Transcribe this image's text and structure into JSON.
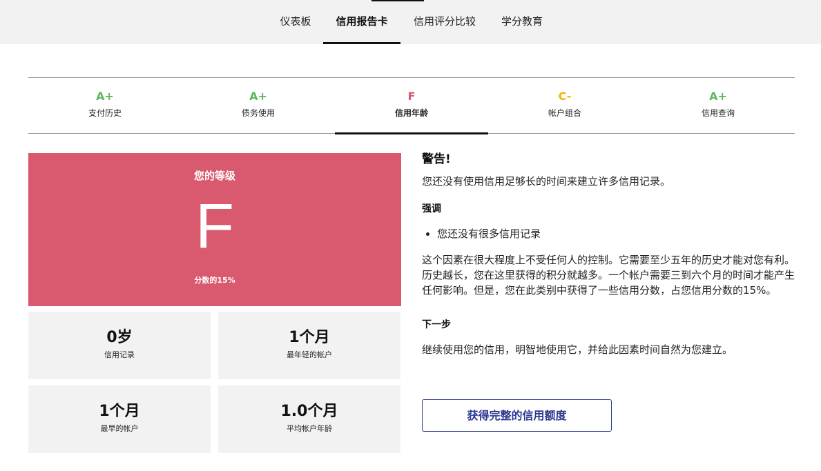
{
  "nav": {
    "tabs": [
      {
        "label": "仪表板"
      },
      {
        "label": "信用报告卡"
      },
      {
        "label": "信用评分比较"
      },
      {
        "label": "学分教育"
      }
    ],
    "active_index": 1
  },
  "grades": [
    {
      "grade": "A+",
      "name": "支付历史",
      "color": "#5cb85c"
    },
    {
      "grade": "A+",
      "name": "债务使用",
      "color": "#5cb85c"
    },
    {
      "grade": "F",
      "name": "信用年龄",
      "color": "#d9596e"
    },
    {
      "grade": "C-",
      "name": "帐户组合",
      "color": "#f0b400"
    },
    {
      "grade": "A+",
      "name": "信用查询",
      "color": "#5cb85c"
    }
  ],
  "active_grade_index": 2,
  "grade_card": {
    "title": "您的等级",
    "letter": "F",
    "score_text": "分数的15%",
    "color": "#d9596e"
  },
  "stats": [
    {
      "value": "0岁",
      "label": "信用记录"
    },
    {
      "value": "1个月",
      "label": "最年轻的帐户"
    },
    {
      "value": "1个月",
      "label": "最早的帐户"
    },
    {
      "value": "1.0个月",
      "label": "平均帐户年龄"
    }
  ],
  "detail": {
    "warning_title": "警告!",
    "warning_text": "您还没有使用信用足够长的时间来建立许多信用记录。",
    "emphasis_title": "强调",
    "bullets": [
      "您还没有很多信用记录"
    ],
    "paragraph": "这个因素在很大程度上不受任何人的控制。它需要至少五年的历史才能对您有利。历史越长，您在这里获得的积分就越多。一个帐户需要三到六个月的时间才能产生任何影响。但是，您在此类别中获得了一些信用分数，占您信用分数的15%。",
    "next_title": "下一步",
    "next_text": "继续使用您的信用，明智地使用它，并给此因素时间自然为您建立。",
    "cta_label": "获得完整的信用额度"
  }
}
